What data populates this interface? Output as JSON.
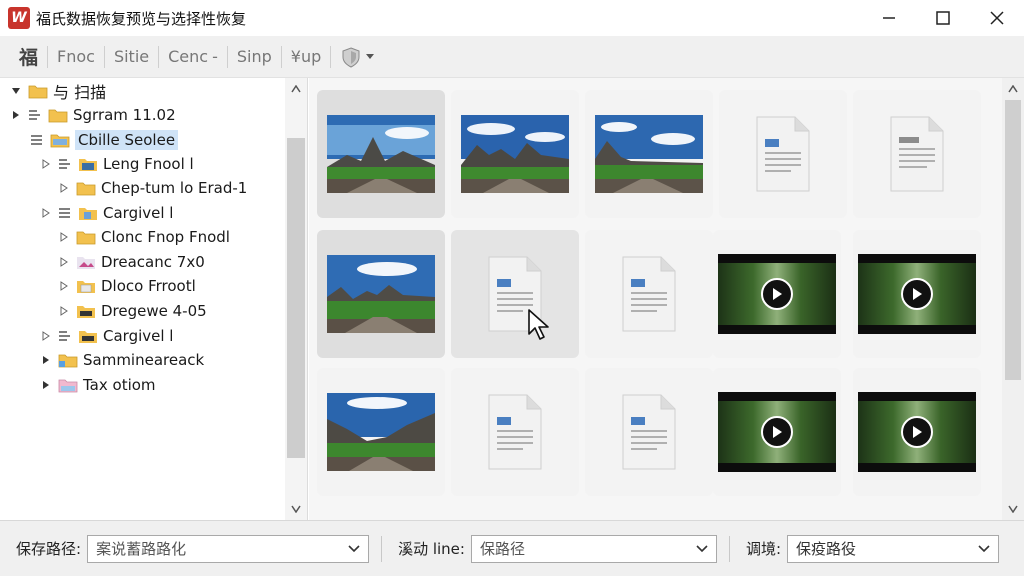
{
  "window": {
    "title": "福氏数据恢复预览与选择性恢复",
    "logo_letter": "W",
    "controls": [
      "minimize",
      "maximize",
      "close"
    ]
  },
  "toolbar": {
    "items": [
      "福",
      "Fnoc",
      "Sitie",
      "Cenc",
      "-",
      "Sinp",
      "¥up"
    ]
  },
  "tree": {
    "root_label": "与 扫描",
    "items": [
      {
        "label": "Sgrram 11.02",
        "expanded": false
      },
      {
        "label": "Cbille Seolee",
        "selected": true
      },
      {
        "label": "Leng Fnool l"
      },
      {
        "label": "Chep-tum lo Erad-1"
      },
      {
        "label": "Cargivel l"
      },
      {
        "label": "Clonc Fnop Fnodl"
      },
      {
        "label": "Dreacanc 7x0"
      },
      {
        "label": "Dloco Frrootl"
      },
      {
        "label": "Dregewe 4-05"
      },
      {
        "label": "Cargivel l"
      },
      {
        "label": "Sammineareack"
      },
      {
        "label": "Tax otiom"
      }
    ]
  },
  "grid": {
    "rows": [
      [
        "photo",
        "photo",
        "photo",
        "document",
        "document-alt"
      ],
      [
        "photo",
        "document",
        "document",
        "video",
        "video"
      ],
      [
        "photo",
        "document",
        "document",
        "video",
        "video"
      ]
    ]
  },
  "bottom": {
    "save_path_label": "保存路径:",
    "save_path_value": "案说蓄路路化",
    "line_label": "溪动 line:",
    "line_value": "保路径",
    "third_label": "调境:",
    "third_value": "保疫路役"
  },
  "colors": {
    "logo": "#c8342c",
    "selection": "#cfe3f7",
    "folder": "#f2c14e",
    "doc_accent": "#4a7fc1"
  }
}
